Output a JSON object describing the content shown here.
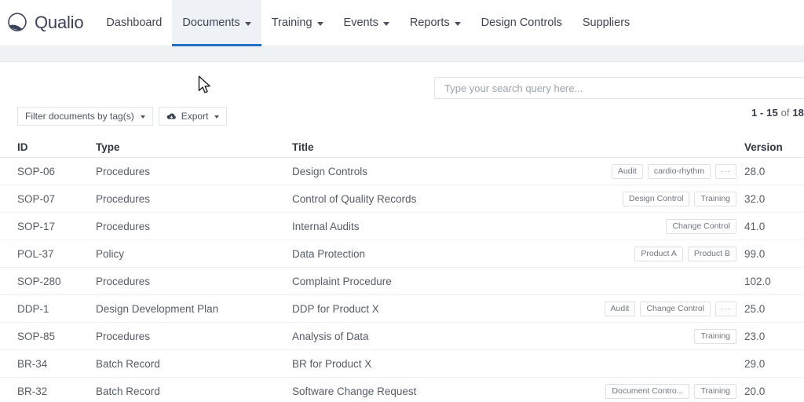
{
  "brand": {
    "name": "Qualio",
    "logo_icon": "qualio-circle-swoosh-logo"
  },
  "nav": {
    "items": [
      {
        "label": "Dashboard",
        "has_caret": false,
        "active": false
      },
      {
        "label": "Documents",
        "has_caret": true,
        "active": true
      },
      {
        "label": "Training",
        "has_caret": true,
        "active": false
      },
      {
        "label": "Events",
        "has_caret": true,
        "active": false
      },
      {
        "label": "Reports",
        "has_caret": true,
        "active": false
      },
      {
        "label": "Design Controls",
        "has_caret": false,
        "active": false
      },
      {
        "label": "Suppliers",
        "has_caret": false,
        "active": false
      }
    ],
    "active_accent_color": "#1f6fc4",
    "active_bg_color": "#eef2f6"
  },
  "toolbar": {
    "search_placeholder": "Type your search query here...",
    "search_value": "",
    "filter_label": "Filter documents by tag(s)",
    "export_label": "Export",
    "export_icon": "cloud-download-icon",
    "pagination_range": "1 - 15",
    "pagination_of": "of",
    "pagination_total": "18"
  },
  "table": {
    "columns": [
      "ID",
      "Type",
      "Title",
      "Version"
    ],
    "rows": [
      {
        "id": "SOP-06",
        "type": "Procedures",
        "title": "Design Controls",
        "tags": [
          "Audit",
          "cardio-rhythm"
        ],
        "more": true,
        "version": "28.0"
      },
      {
        "id": "SOP-07",
        "type": "Procedures",
        "title": "Control of Quality Records",
        "tags": [
          "Design Control",
          "Training"
        ],
        "more": false,
        "version": "32.0"
      },
      {
        "id": "SOP-17",
        "type": "Procedures",
        "title": "Internal Audits",
        "tags": [
          "Change Control"
        ],
        "more": false,
        "version": "41.0"
      },
      {
        "id": "POL-37",
        "type": "Policy",
        "title": "Data Protection",
        "tags": [
          "Product A",
          "Product B"
        ],
        "more": false,
        "version": "99.0"
      },
      {
        "id": "SOP-280",
        "type": "Procedures",
        "title": "Complaint Procedure",
        "tags": [],
        "more": false,
        "version": "102.0"
      },
      {
        "id": "DDP-1",
        "type": "Design Development Plan",
        "title": "DDP for Product X",
        "tags": [
          "Audit",
          "Change Control"
        ],
        "more": true,
        "version": "25.0"
      },
      {
        "id": "SOP-85",
        "type": "Procedures",
        "title": "Analysis of Data",
        "tags": [
          "Training"
        ],
        "more": false,
        "version": "23.0"
      },
      {
        "id": "BR-34",
        "type": "Batch Record",
        "title": "BR for Product X",
        "tags": [],
        "more": false,
        "version": "29.0"
      },
      {
        "id": "BR-32",
        "type": "Batch Record",
        "title": "Software Change Request",
        "tags": [
          "Document Contro...",
          "Training"
        ],
        "more": false,
        "version": "20.0"
      }
    ],
    "more_glyph": "···"
  },
  "cursor": {
    "icon": "arrow-pointer"
  }
}
